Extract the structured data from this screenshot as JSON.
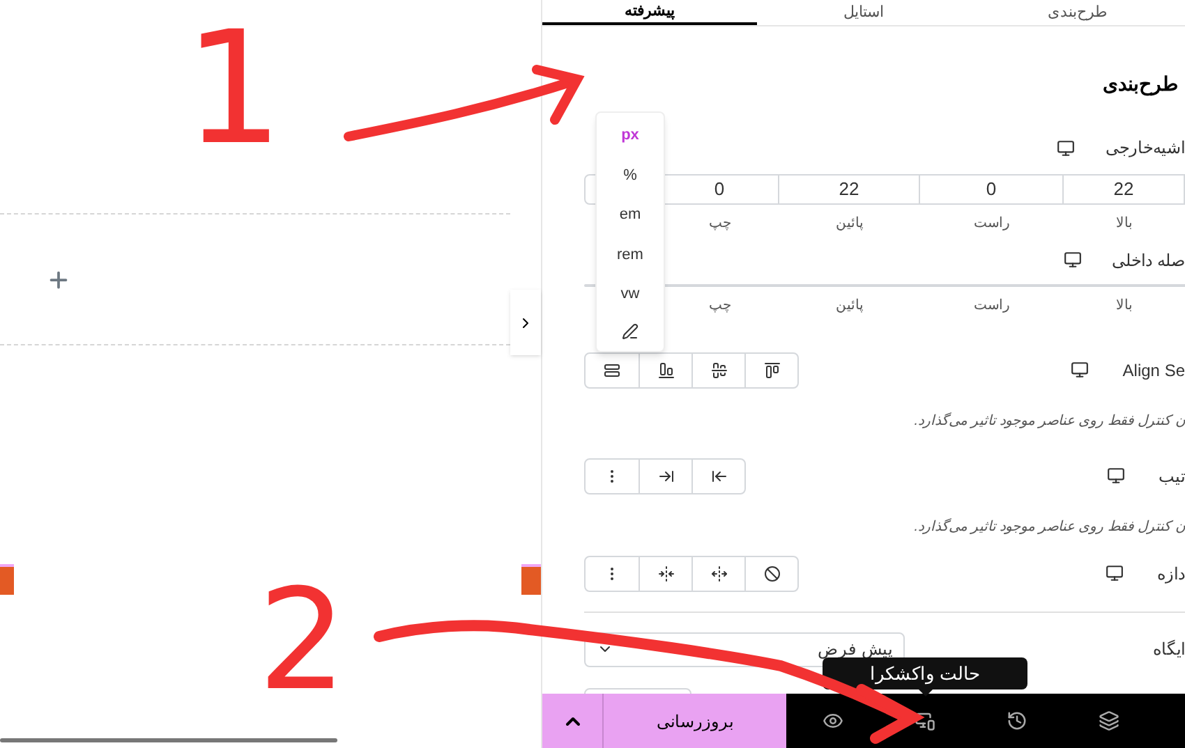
{
  "tabs": [
    {
      "label": "طرح‌بندی",
      "selected": false
    },
    {
      "label": "استایل",
      "selected": false
    },
    {
      "label": "پیشرفته",
      "selected": true
    }
  ],
  "section_title": "طرح‌بندی",
  "margin": {
    "label": "اشیه‌خارجی",
    "values": [
      "22",
      "0",
      "22",
      "0"
    ],
    "sides": [
      "بالا",
      "راست",
      "پائین",
      "چپ"
    ]
  },
  "padding": {
    "label": "صله داخلی",
    "sides": [
      "بالا",
      "راست",
      "پائین",
      "چپ"
    ]
  },
  "unit_menu": [
    {
      "label": "px",
      "selected": true
    },
    {
      "label": "%",
      "selected": false
    },
    {
      "label": "em",
      "selected": false
    },
    {
      "label": "rem",
      "selected": false
    },
    {
      "label": "vw",
      "selected": false
    }
  ],
  "controls": [
    {
      "kind": "align",
      "label": "Align Se",
      "note": "ن کنترل فقط روی عناصر موجود تاثیر می‌گذارد."
    },
    {
      "kind": "order",
      "label": "تیب",
      "note": "ن کنترل فقط روی عناصر موجود تاثیر می‌گذارد."
    },
    {
      "kind": "size",
      "label": "دازه"
    }
  ],
  "position": {
    "label": "ایگاه",
    "value": "پیش فرض"
  },
  "tooltip": "حالت واکشکرا",
  "footer": {
    "update_button": "بروزرسانی"
  },
  "annotations": [
    "1",
    "2"
  ]
}
